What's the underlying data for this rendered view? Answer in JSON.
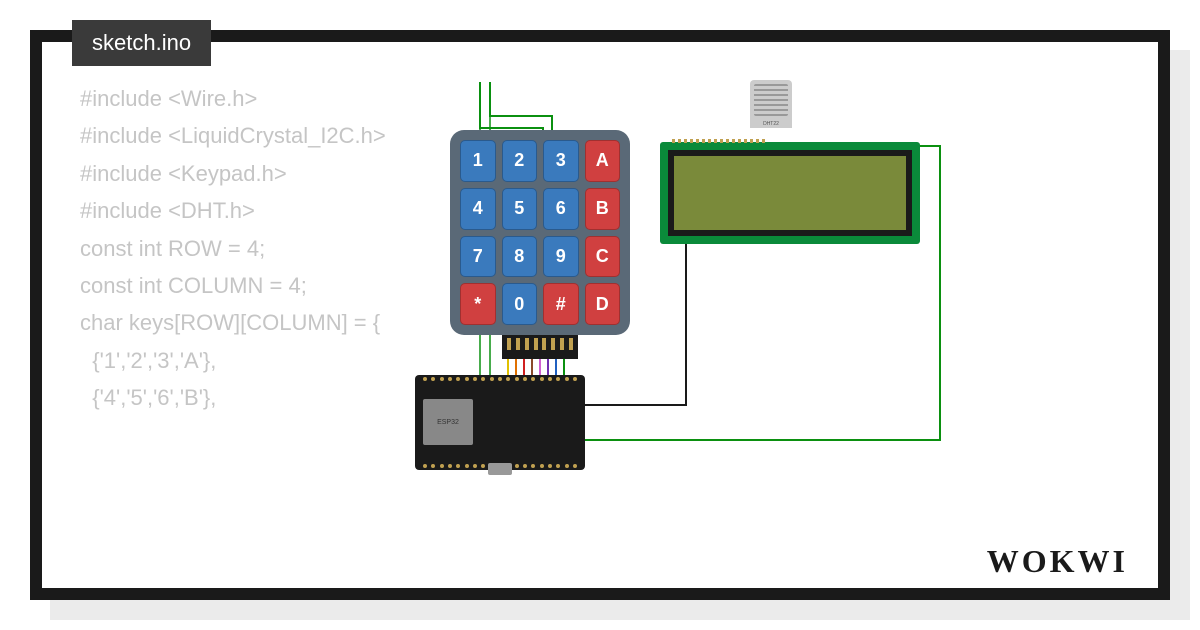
{
  "tab": {
    "filename": "sketch.ino"
  },
  "code": {
    "lines": [
      "#include <Wire.h>",
      "#include <LiquidCrystal_I2C.h>",
      "#include <Keypad.h>",
      "#include <DHT.h>",
      "",
      "const int ROW = 4;",
      "const int COLUMN = 4;",
      "char keys[ROW][COLUMN] = {",
      "  {'1','2','3','A'},",
      "  {'4','5','6','B'},"
    ]
  },
  "keypad": {
    "keys": [
      {
        "label": "1",
        "color": "blue"
      },
      {
        "label": "2",
        "color": "blue"
      },
      {
        "label": "3",
        "color": "blue"
      },
      {
        "label": "A",
        "color": "red"
      },
      {
        "label": "4",
        "color": "blue"
      },
      {
        "label": "5",
        "color": "blue"
      },
      {
        "label": "6",
        "color": "blue"
      },
      {
        "label": "B",
        "color": "red"
      },
      {
        "label": "7",
        "color": "blue"
      },
      {
        "label": "8",
        "color": "blue"
      },
      {
        "label": "9",
        "color": "blue"
      },
      {
        "label": "C",
        "color": "red"
      },
      {
        "label": "*",
        "color": "red"
      },
      {
        "label": "0",
        "color": "blue"
      },
      {
        "label": "#",
        "color": "red"
      },
      {
        "label": "D",
        "color": "red"
      }
    ]
  },
  "components": {
    "dht22_label": "DHT22",
    "esp32_label": "ESP32"
  },
  "branding": {
    "logo": "WOKWI"
  }
}
